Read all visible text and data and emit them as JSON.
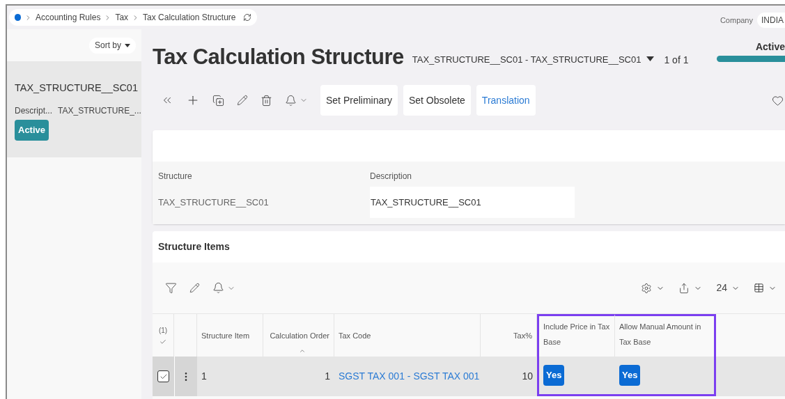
{
  "breadcrumb": [
    {
      "label": "Accounting Rules"
    },
    {
      "label": "Tax"
    },
    {
      "label": "Tax Calculation Structure"
    }
  ],
  "company": {
    "label": "Company",
    "value": "INDIA"
  },
  "sidebar": {
    "sort_label": "Sort by",
    "items": [
      {
        "title": "TAX_STRUCTURE__SC01",
        "field_label": "Descript...",
        "field_value": "TAX_STRUCTURE_...",
        "status": "Active",
        "selected": true
      }
    ]
  },
  "header": {
    "title": "Tax Calculation Structure",
    "record": "TAX_STRUCTURE__SC01 - TAX_STRUCTURE__SC01",
    "count": "1 of 1",
    "status": "Active"
  },
  "toolbar_buttons": [
    {
      "label": "Set Preliminary",
      "kind": "plain"
    },
    {
      "label": "Set Obsolete",
      "kind": "plain"
    },
    {
      "label": "Translation",
      "kind": "link"
    }
  ],
  "form": {
    "fields": [
      {
        "label": "Structure",
        "value": "TAX_STRUCTURE__SC01",
        "editable": false
      },
      {
        "label": "Description",
        "value": "TAX_STRUCTURE__SC01",
        "editable": true
      }
    ]
  },
  "items": {
    "title": "Structure Items",
    "page_size": "24",
    "selection_count": "(1)",
    "columns": [
      {
        "label": "Structure Item",
        "kind": "text",
        "sorted": false,
        "highlighted": false
      },
      {
        "label": "Calculation Order",
        "kind": "number",
        "sorted": true,
        "highlighted": false
      },
      {
        "label": "Tax Code",
        "kind": "link",
        "sorted": false,
        "highlighted": false
      },
      {
        "label": "Tax%",
        "kind": "number",
        "sorted": false,
        "highlighted": false
      },
      {
        "label": "Include Price in Tax Base",
        "kind": "badge",
        "sorted": false,
        "highlighted": true
      },
      {
        "label": "Allow Manual Amount in Tax Base",
        "kind": "badge",
        "sorted": false,
        "highlighted": true
      }
    ],
    "rows": [
      {
        "checked": true,
        "selected": true,
        "cells": [
          "1",
          "1",
          "SGST TAX 001 - SGST TAX 001",
          "10",
          "Yes",
          "Yes"
        ]
      }
    ]
  }
}
